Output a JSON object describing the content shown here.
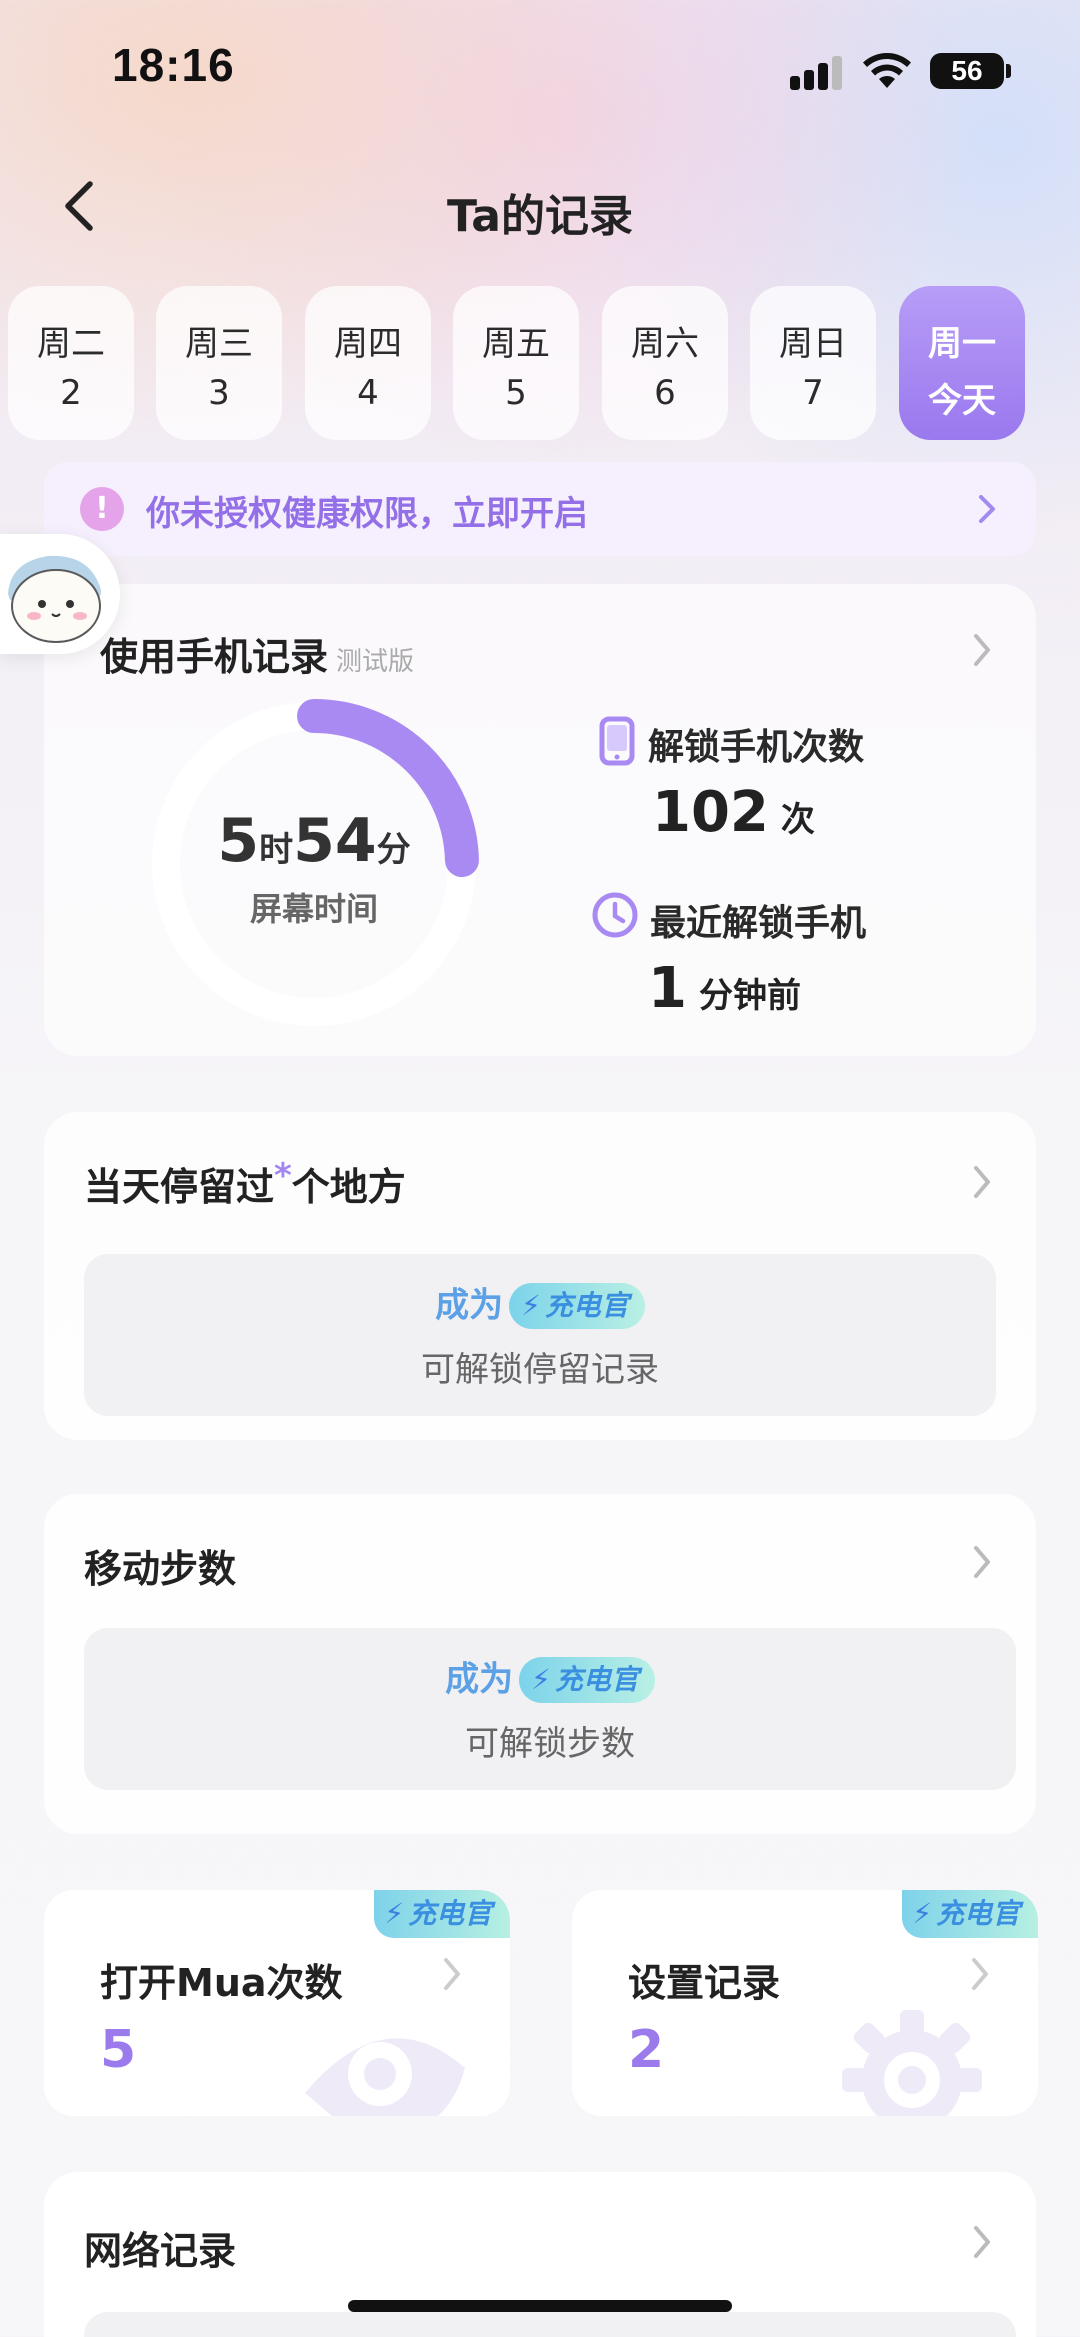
{
  "status_bar": {
    "time": "18:16",
    "battery": "56"
  },
  "header": {
    "title": "Ta的记录"
  },
  "days": [
    {
      "week": "周二",
      "date": "2"
    },
    {
      "week": "周三",
      "date": "3"
    },
    {
      "week": "周四",
      "date": "4"
    },
    {
      "week": "周五",
      "date": "5"
    },
    {
      "week": "周六",
      "date": "6"
    },
    {
      "week": "周日",
      "date": "7"
    },
    {
      "week": "周一",
      "date": "今天",
      "active": true
    }
  ],
  "permission_banner": {
    "icon": "!",
    "text": "你未授权健康权限，立即开启"
  },
  "phone_usage": {
    "title": "使用手机记录",
    "tag": "测试版",
    "screen_time": {
      "hours": "5",
      "hours_unit": "时",
      "minutes": "54",
      "minutes_unit": "分",
      "label": "屏幕时间"
    },
    "screen_time_fraction": 0.2458,
    "unlock_count": {
      "label": "解锁手机次数",
      "value": "102",
      "unit": "次"
    },
    "last_unlock": {
      "label": "最近解锁手机",
      "value": "1",
      "unit": "分钟前"
    }
  },
  "places": {
    "title_prefix": "当天停留过",
    "title_star": "*",
    "title_suffix": "个地方",
    "become": "成为",
    "badge": "充电官",
    "unlock_text": "可解锁停留记录"
  },
  "steps": {
    "title": "移动步数",
    "become": "成为",
    "badge": "充电官",
    "unlock_text": "可解锁步数"
  },
  "open_mua": {
    "title": "打开Mua次数",
    "value": "5",
    "badge": "充电官"
  },
  "settings_record": {
    "title": "设置记录",
    "value": "2",
    "badge": "充电官"
  },
  "network": {
    "title": "网络记录"
  },
  "colors": {
    "accent": "#9b7bec",
    "vip_blue": "#3b8fe0",
    "banner_text": "#9370e8"
  }
}
